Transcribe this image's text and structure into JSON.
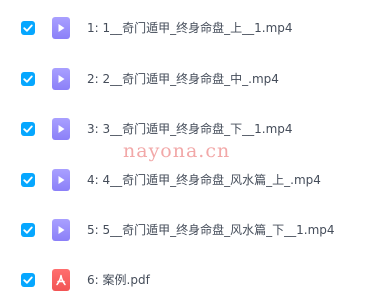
{
  "file_list": {
    "items": [
      {
        "index": "1:",
        "name": "1__奇门遁甲_终身命盘_上__1.mp4",
        "type": "video",
        "checked": true
      },
      {
        "index": "2:",
        "name": "2__奇门遁甲_终身命盘_中_.mp4",
        "type": "video",
        "checked": true
      },
      {
        "index": "3:",
        "name": "3__奇门遁甲_终身命盘_下__1.mp4",
        "type": "video",
        "checked": true
      },
      {
        "index": "4:",
        "name": "4__奇门遁甲_终身命盘_风水篇_上_.mp4",
        "type": "video",
        "checked": true
      },
      {
        "index": "5:",
        "name": "5__奇门遁甲_终身命盘_风水篇_下__1.mp4",
        "type": "video",
        "checked": true
      },
      {
        "index": "6:",
        "name": "案例.pdf",
        "type": "pdf",
        "checked": true
      }
    ]
  },
  "watermark": {
    "text": "nayona.cn"
  },
  "colors": {
    "checkbox": "#06a7ff",
    "video_icon": "#9d93fb",
    "pdf_icon": "#f25f5f",
    "text": "#454d5a",
    "watermark": "#f2a8a8"
  }
}
